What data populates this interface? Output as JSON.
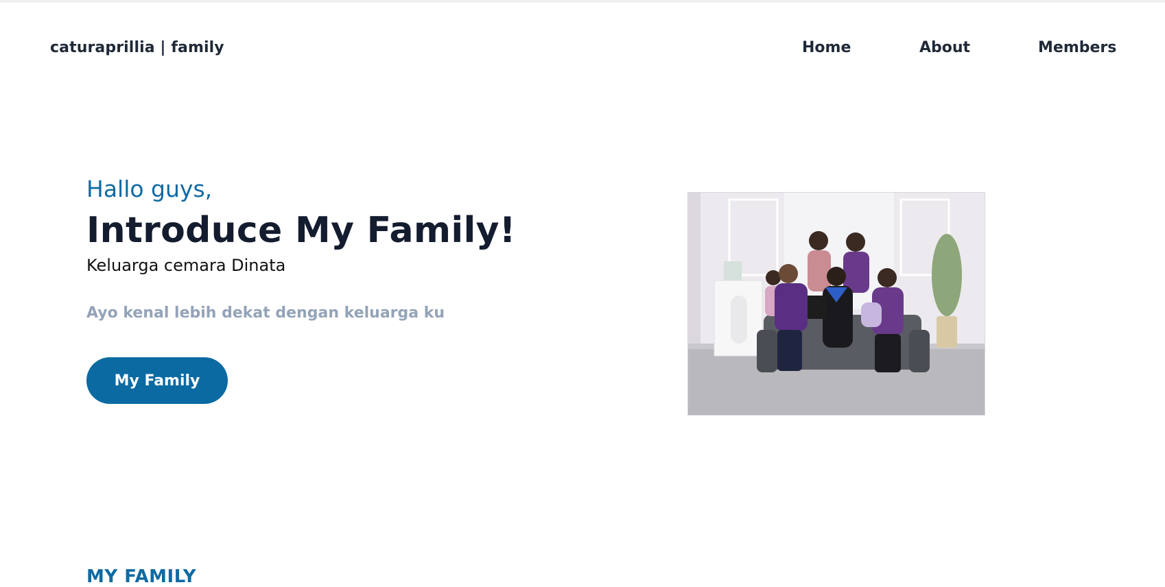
{
  "header": {
    "brand": "caturaprillia | family",
    "nav": {
      "home": "Home",
      "about": "About",
      "members": "Members"
    }
  },
  "hero": {
    "greeting": "Hallo guys,",
    "title": "Introduce My Family!",
    "subtitle": "Keluarga cemara Dinata",
    "tagline": "Ayo kenal lebih dekat dengan keluarga ku",
    "button_label": "My Family",
    "image_alt": "family-photo"
  },
  "section": {
    "heading": "MY FAMILY"
  },
  "colors": {
    "accent": "#0b6aa2",
    "heading": "#141c2f",
    "muted": "#94a3b8"
  }
}
